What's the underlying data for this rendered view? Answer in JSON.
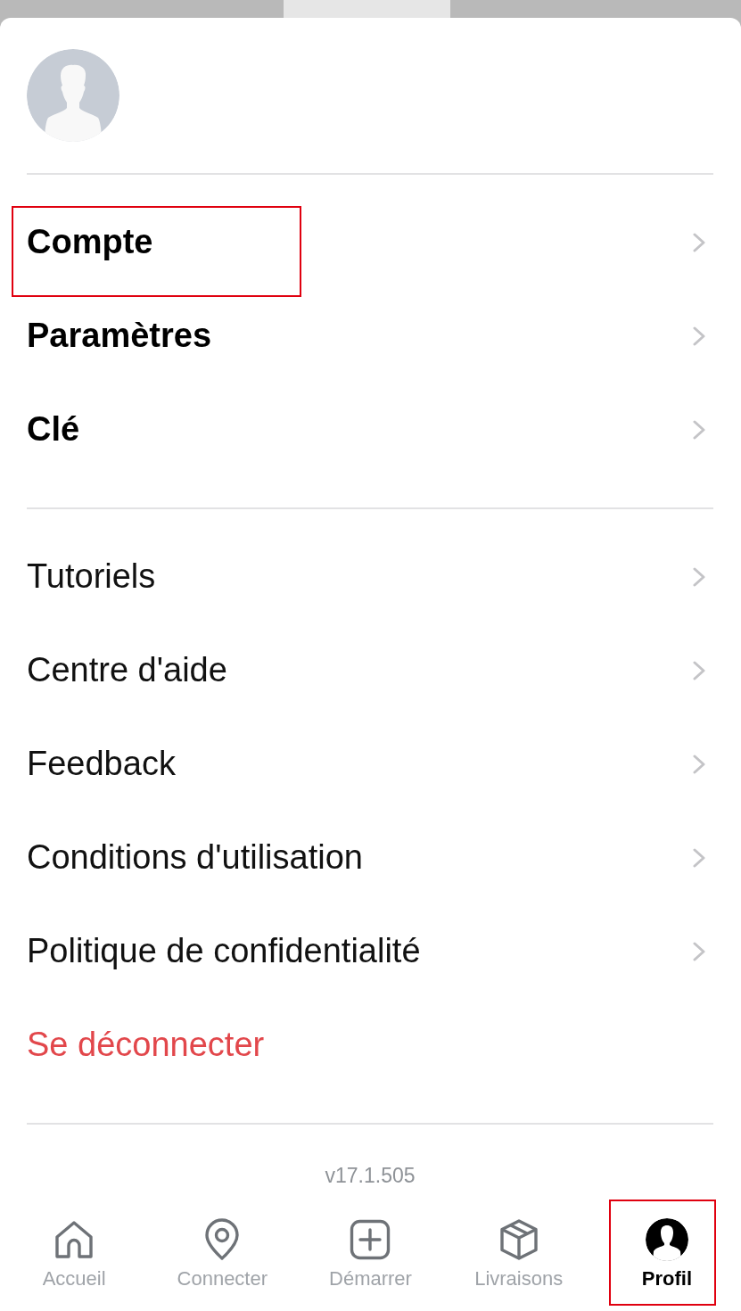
{
  "menu_sections": [
    {
      "items": [
        {
          "kind": "primary",
          "label": "Compte",
          "highlighted": true
        },
        {
          "kind": "primary",
          "label": "Paramètres",
          "highlighted": false
        },
        {
          "kind": "primary",
          "label": "Clé",
          "highlighted": false
        }
      ]
    },
    {
      "items": [
        {
          "kind": "secondary",
          "label": "Tutoriels",
          "highlighted": false
        },
        {
          "kind": "secondary",
          "label": "Centre d'aide",
          "highlighted": false
        },
        {
          "kind": "secondary",
          "label": "Feedback",
          "highlighted": false
        },
        {
          "kind": "secondary",
          "label": "Conditions d'utilisation",
          "highlighted": false
        },
        {
          "kind": "secondary",
          "label": "Politique de confidentialité",
          "highlighted": false
        },
        {
          "kind": "destructive",
          "label": "Se déconnecter",
          "highlighted": false
        }
      ]
    }
  ],
  "version": "v17.1.505",
  "tab_bar": [
    {
      "label": "Accueil",
      "selected": false,
      "highlighted": false
    },
    {
      "label": "Connecter",
      "selected": false,
      "highlighted": false
    },
    {
      "label": "Démarrer",
      "selected": false,
      "highlighted": false
    },
    {
      "label": "Livraisons",
      "selected": false,
      "highlighted": false
    },
    {
      "label": "Profil",
      "selected": true,
      "highlighted": true
    }
  ]
}
